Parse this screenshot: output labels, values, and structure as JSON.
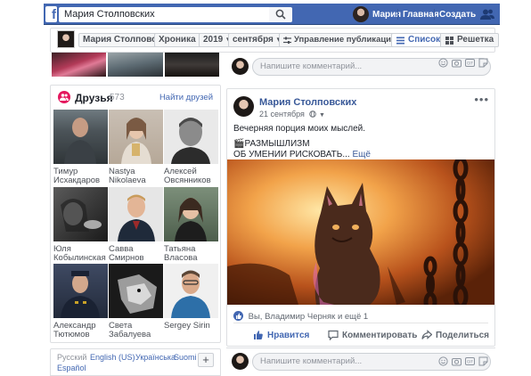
{
  "topbar": {
    "search_value": "Мария Столповских",
    "user_name": "Мария",
    "home_label": "Главная",
    "create_label": "Создать",
    "brand_color": "#4267b2"
  },
  "subbar": {
    "name": "Мария Столповских",
    "section": "Хроника",
    "year": "2019",
    "month": "сентября",
    "manage_label": "Управление публикациями",
    "list_label": "Список",
    "grid_label": "Решетка"
  },
  "friends": {
    "title": "Друзья",
    "count": "573",
    "find_label": "Найти друзей",
    "items": [
      {
        "name": "Тимур Исхакдаров"
      },
      {
        "name": "Nastya Nikolaeva"
      },
      {
        "name": "Алексей Овсянников"
      },
      {
        "name": "Юля Кобылинская"
      },
      {
        "name": "Савва Смирнов"
      },
      {
        "name": "Татьяна Власова"
      },
      {
        "name": "Александр Тютюмов"
      },
      {
        "name": "Света Забалуева"
      },
      {
        "name": "Sergey Sirin"
      }
    ]
  },
  "languages": {
    "current": "Русский",
    "items": [
      "English (US)",
      "Українська",
      "Suomi",
      "Español"
    ],
    "add_label": "+"
  },
  "comment_placeholder": "Напишите комментарий...",
  "post": {
    "author": "Мария Столповских",
    "date": "21 сентября",
    "line1": "Вечерняя порция моих мыслей.",
    "line2": "🎬РАЗМЫШЛИЗМ",
    "line3": "ОБ УМЕНИИ РИСКОВАТЬ...",
    "more_label": "Ещё",
    "reactions": "Вы, Владимир Черняк и ещё 1",
    "like_label": "Нравится",
    "comment_label": "Комментировать",
    "share_label": "Поделиться"
  }
}
